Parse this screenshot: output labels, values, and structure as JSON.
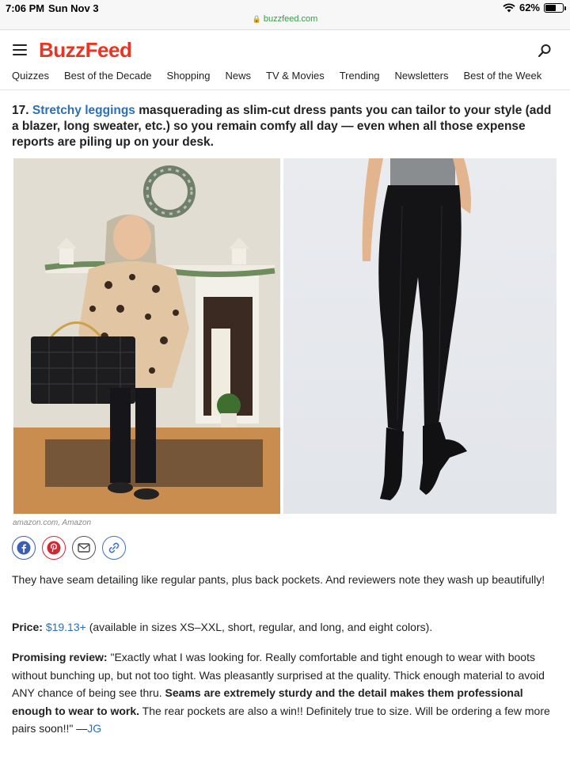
{
  "status_bar": {
    "time": "7:06 PM",
    "date": "Sun Nov 3",
    "battery": "62%",
    "battery_level": 0.62,
    "url": "buzzfeed.com"
  },
  "header": {
    "logo": "BuzzFeed",
    "nav": [
      "Quizzes",
      "Best of the Decade",
      "Shopping",
      "News",
      "TV & Movies",
      "Trending",
      "Newsletters",
      "Best of the Week"
    ]
  },
  "article": {
    "item_number": "17.",
    "item_link": "Stretchy leggings",
    "item_text": " masquerading as slim-cut dress pants you can tailor to your style (add a blazer, long sweater, etc.) so you remain comfy all day — even when all those expense reports are piling up on your desk.",
    "image_caption": "amazon.com, Amazon",
    "paragraph1": "They have seam detailing like regular pants, plus back pockets. And reviewers note they wash up beautifully!",
    "price_label": "Price:",
    "price_value": "$19.13+",
    "price_text": " (available in sizes XS–XXL, short, regular, and long, and eight colors).",
    "review_label": "Promising review:",
    "review_part1": " \"Exactly what I was looking for. Really comfortable and tight enough to wear with boots without bunching up, but not too tight. Was pleasantly surprised at the quality. Thick enough material to avoid ANY chance of being see thru. ",
    "review_bold": "Seams are extremely sturdy and the detail makes them professional enough to wear to work.",
    "review_part2": " The rear pockets are also a win!! Definitely true to size. Will be ordering a few more pairs soon!!\" —",
    "review_author": "JG"
  },
  "share_icons": [
    "facebook-icon",
    "pinterest-icon",
    "mail-icon",
    "link-icon"
  ],
  "colors": {
    "brand_red": "#ee3322",
    "link_blue": "#2a6fb7",
    "url_green": "#2f9e44"
  }
}
